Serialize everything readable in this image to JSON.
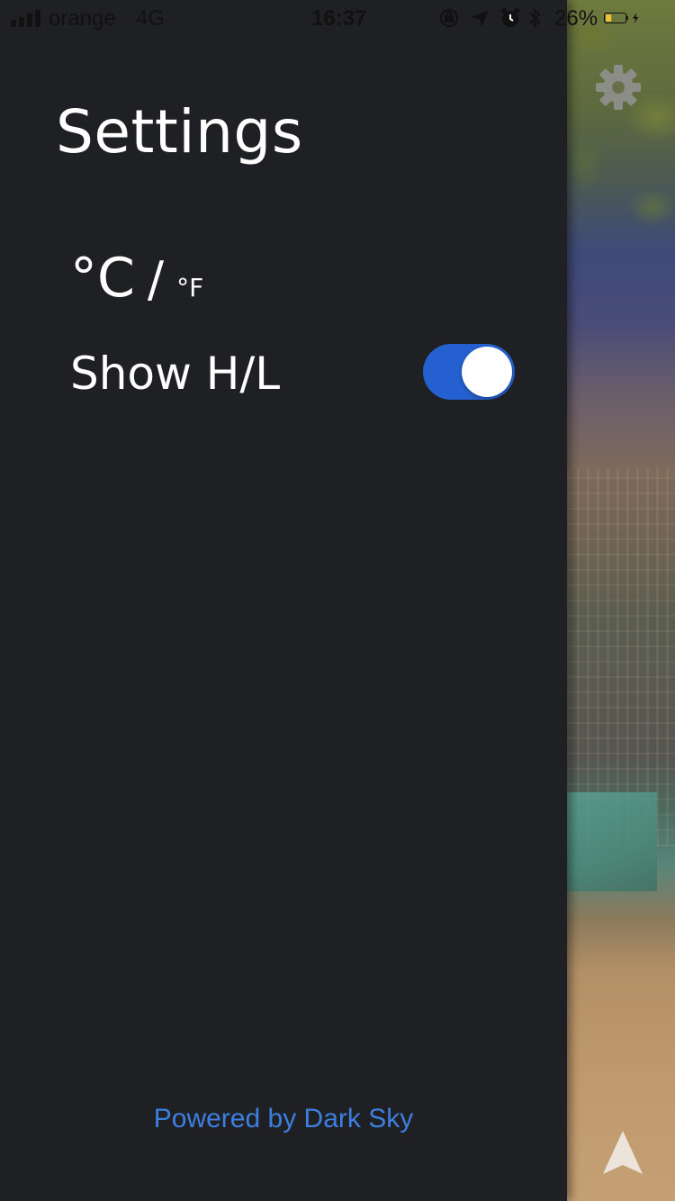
{
  "status_bar": {
    "carrier": "orange",
    "network": "4G",
    "time": "16:37",
    "battery_percent": "26%",
    "icons": [
      "orientation-lock-icon",
      "location-icon",
      "alarm-icon",
      "bluetooth-icon",
      "battery-icon",
      "charging-icon"
    ]
  },
  "settings": {
    "title": "Settings",
    "units": {
      "celsius": "°C",
      "separator": "/",
      "fahrenheit": "°F",
      "selected": "°C"
    },
    "show_hl": {
      "label": "Show H/L",
      "enabled": true
    }
  },
  "footer": {
    "powered_by": "Powered by Dark Sky"
  },
  "colors": {
    "drawer_bg": "#1f2023",
    "toggle_on": "#2460cf",
    "link": "#3d7fe0"
  }
}
